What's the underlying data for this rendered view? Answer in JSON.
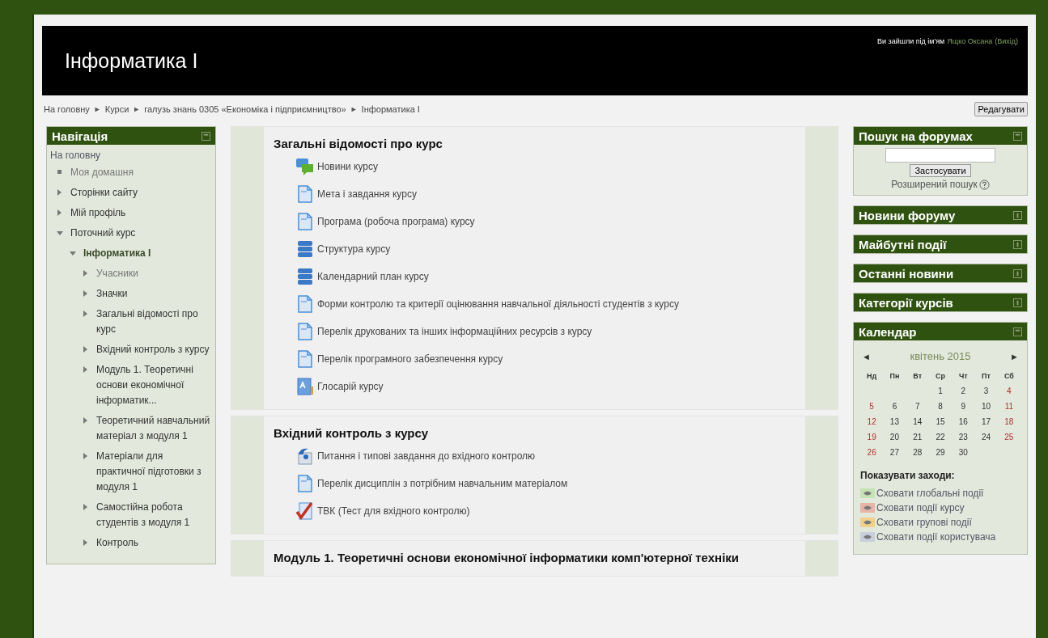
{
  "header": {
    "title": "Інформатика I",
    "login": {
      "prefix": "Ви зайшли під ім'ям",
      "user": "Ящко Оксана",
      "logout": "(Вихід)"
    }
  },
  "breadcrumb": [
    "На головну",
    "Курси",
    "галузь знань 0305 «Економіка і підприємництво»",
    "Інформатика I"
  ],
  "breadcrumb_separator": "►",
  "edit_button": "Редагувати",
  "navigation": {
    "title": "Навігація",
    "expanded": true,
    "home": "На головну",
    "items": [
      {
        "label": "Моя домашня",
        "kind": "leaf",
        "dimmed": true
      },
      {
        "label": "Сторінки сайту",
        "kind": "branch",
        "expanded": false,
        "dimmed": false
      },
      {
        "label": "Мій профіль",
        "kind": "branch",
        "expanded": false,
        "dimmed": false
      },
      {
        "label": "Поточний курс",
        "kind": "branch",
        "expanded": true,
        "dimmed": false,
        "children": [
          {
            "label": "Інформатика I",
            "kind": "branch",
            "expanded": true,
            "dimmed": false,
            "current": true,
            "children": [
              {
                "label": "Учасники",
                "kind": "branch",
                "expanded": false,
                "dimmed": true
              },
              {
                "label": "Значки",
                "kind": "branch",
                "expanded": false,
                "dimmed": false
              },
              {
                "label": "Загальні відомості про курс",
                "kind": "branch",
                "expanded": false,
                "dimmed": false
              },
              {
                "label": "Вхідний контроль з курсу",
                "kind": "branch",
                "expanded": false,
                "dimmed": false
              },
              {
                "label": "Модуль 1. Теоретичні основи економічної інформатик...",
                "kind": "branch",
                "expanded": false,
                "dimmed": false
              },
              {
                "label": "Теоретичний навчальний матеріал з модуля 1",
                "kind": "branch",
                "expanded": false,
                "dimmed": false
              },
              {
                "label": "Матеріали для практичної підготовки з модуля 1",
                "kind": "branch",
                "expanded": false,
                "dimmed": false
              },
              {
                "label": "Самостійна робота студентів з модуля 1",
                "kind": "branch",
                "expanded": false,
                "dimmed": false
              },
              {
                "label": "Контроль",
                "kind": "branch",
                "expanded": false,
                "dimmed": false
              }
            ]
          }
        ]
      }
    ]
  },
  "sections": [
    {
      "title": "Загальні відомості про курс",
      "activities": [
        {
          "name": "Новини курсу",
          "kind": "forum"
        },
        {
          "name": "Мета і завдання курсу",
          "kind": "page"
        },
        {
          "name": "Програма (робоча програма) курсу",
          "kind": "page"
        },
        {
          "name": "Структура курсу",
          "kind": "folder"
        },
        {
          "name": "Календарний план курсу",
          "kind": "folder"
        },
        {
          "name": "Форми контролю та критерії оцінювання навчальної діяльності студентів з курсу",
          "kind": "page"
        },
        {
          "name": "Перелік друкованих та інших інформаційних ресурсів з курсу",
          "kind": "page"
        },
        {
          "name": "Перелік програмного забезпечення курсу",
          "kind": "page"
        },
        {
          "name": "Глосарій курсу",
          "kind": "glossary"
        }
      ]
    },
    {
      "title": "Вхідний контроль з курсу",
      "activities": [
        {
          "name": "Питання і типові завдання до вхідного контролю",
          "kind": "feedback"
        },
        {
          "name": "Перелік дисциплін з потрібним навчальним матеріалом",
          "kind": "page"
        },
        {
          "name": "ТВК (Тест для вхідного контролю)",
          "kind": "quiz"
        }
      ]
    },
    {
      "title": "Модуль 1. Теоретичні основи економічної інформатики комп'ютерної техніки"
    }
  ],
  "search_block": {
    "title": "Пошук на форумах",
    "expanded": true,
    "button": "Застосувати",
    "advanced": "Розширений пошук"
  },
  "blocks": [
    {
      "title": "Новини форуму",
      "expanded": false
    },
    {
      "title": "Майбутні події",
      "expanded": false
    },
    {
      "title": "Останні новини",
      "expanded": false
    },
    {
      "title": "Категорії курсів",
      "expanded": false
    }
  ],
  "calendar": {
    "title": "Календар",
    "expanded": true,
    "prev": "◄",
    "next": "►",
    "month": "квітень 2015",
    "weekdays": [
      "Нд",
      "Пн",
      "Вт",
      "Ср",
      "Чт",
      "Пт",
      "Сб"
    ],
    "weeks": [
      [
        "1",
        "2",
        "3",
        "4"
      ],
      [
        "5",
        "6",
        "7",
        "8",
        "9",
        "10",
        "11"
      ],
      [
        "12",
        "13",
        "14",
        "15",
        "16",
        "17",
        "18"
      ],
      [
        "19",
        "20",
        "21",
        "22",
        "23",
        "24",
        "25"
      ],
      [
        "26",
        "27",
        "28",
        "29",
        "30"
      ]
    ],
    "legend_title": "Показувати заходи:",
    "legend": [
      {
        "label": "Сховати глобальні події",
        "color": "#c4e4b4"
      },
      {
        "label": "Сховати події курсу",
        "color": "#e8b4a8"
      },
      {
        "label": "Сховати групові події",
        "color": "#f0d08c"
      },
      {
        "label": "Сховати події користувача",
        "color": "#c8cedc"
      }
    ]
  }
}
